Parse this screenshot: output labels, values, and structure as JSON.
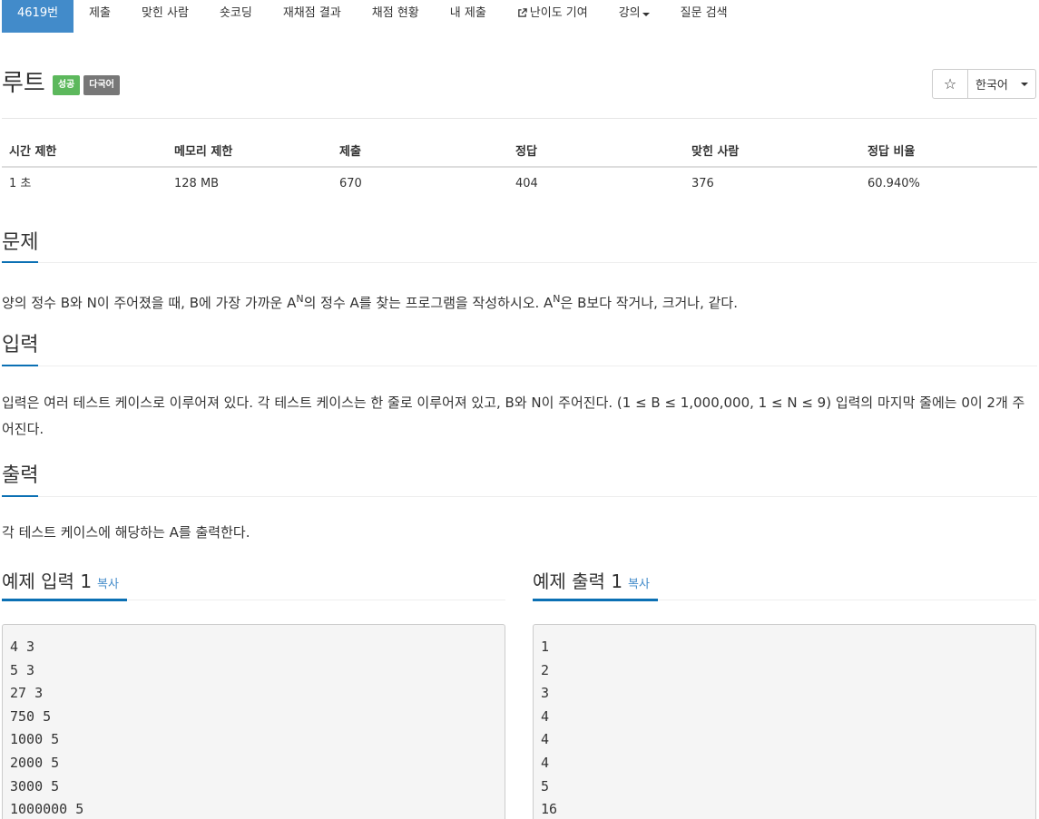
{
  "nav": {
    "items": [
      {
        "label": "4619번",
        "active": true
      },
      {
        "label": "제출"
      },
      {
        "label": "맞힌 사람"
      },
      {
        "label": "숏코딩"
      },
      {
        "label": "재채점 결과"
      },
      {
        "label": "채점 현황"
      },
      {
        "label": "내 제출"
      },
      {
        "label": "난이도 기여",
        "icon": "external-link-icon"
      },
      {
        "label": "강의",
        "icon": "caret-down-icon"
      },
      {
        "label": "질문 검색"
      }
    ]
  },
  "problem": {
    "title": "루트",
    "badges": [
      "성공",
      "다국어"
    ],
    "star_icon": "☆",
    "language": "한국어"
  },
  "stats": {
    "headers": [
      "시간 제한",
      "메모리 제한",
      "제출",
      "정답",
      "맞힌 사람",
      "정답 비율"
    ],
    "values": [
      "1 초",
      "128 MB",
      "670",
      "404",
      "376",
      "60.940%"
    ]
  },
  "sections": {
    "description": {
      "heading": "문제",
      "text_a": "양의 정수 B와 N이 주어졌을 때, B에 가장 가까운 A",
      "sup_1": "N",
      "text_b": "의 정수 A를 찾는 프로그램을 작성하시오. A",
      "sup_2": "N",
      "text_c": "은 B보다 작거나, 크거나, 같다."
    },
    "input": {
      "heading": "입력",
      "text": "입력은 여러 테스트 케이스로 이루어져 있다. 각 테스트 케이스는 한 줄로 이루어져 있고, B와 N이 주어진다. (1 ≤ B ≤ 1,000,000, 1 ≤ N ≤ 9) 입력의 마지막 줄에는 0이 2개 주어진다."
    },
    "output": {
      "heading": "출력",
      "text": "각 테스트 케이스에 해당하는 A를 출력한다."
    }
  },
  "samples": {
    "input": {
      "heading": "예제 입력 1",
      "copy_label": "복사",
      "lines": [
        "4 3",
        "5 3",
        "27 3",
        "750 5",
        "1000 5",
        "2000 5",
        "3000 5",
        "1000000 5"
      ]
    },
    "output": {
      "heading": "예제 출력 1",
      "copy_label": "복사",
      "lines": [
        "1",
        "2",
        "3",
        "4",
        "4",
        "4",
        "5",
        "16"
      ]
    }
  },
  "colors": {
    "accent": "#428bca",
    "success": "#5cb85c",
    "default_label": "#777777",
    "heading_underline": "#0b70b4"
  }
}
